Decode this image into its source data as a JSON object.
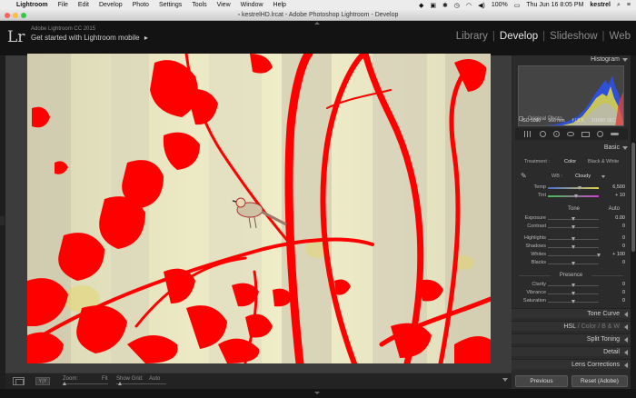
{
  "menubar": {
    "app": "Lightroom",
    "items": [
      "File",
      "Edit",
      "Develop",
      "Photo",
      "Settings",
      "Tools",
      "View",
      "Window",
      "Help"
    ],
    "battery": "100%",
    "datetime": "Thu Jun 16 8:05 PM",
    "user": "kestrel"
  },
  "window": {
    "title": "kestrelHD.lrcat - Adobe Photoshop Lightroom - Develop"
  },
  "identity": {
    "logo": "Lr",
    "product": "Adobe Lightroom CC 2015",
    "tagline": "Get started with Lightroom mobile",
    "tagline_arrow": "▸"
  },
  "modules": {
    "items": [
      "Library",
      "Develop",
      "Slideshow",
      "Web"
    ],
    "active": "Develop",
    "separator": "|"
  },
  "histogram": {
    "title": "Histogram",
    "iso": "ISO 5000",
    "focal": "566 mm",
    "aperture": "f / 5.6",
    "shutter": "1/1600 SEC",
    "original_photo": "Original Photo"
  },
  "toolstrip": {
    "icons": [
      "grid-overlay-icon",
      "crop-icon",
      "spot-removal-icon",
      "red-eye-icon",
      "graduated-filter-icon",
      "radial-filter-icon",
      "adjustment-brush-icon"
    ]
  },
  "basic": {
    "title": "Basic",
    "treatment_label": "Treatment :",
    "color": "Color",
    "bw": "Black & White",
    "wb_label": "WB :",
    "wb_value": "Cloudy",
    "temp_label": "Temp",
    "temp_value": "6,500",
    "temp_pos": 0.62,
    "tint_label": "Tint",
    "tint_value": "+ 10",
    "tint_pos": 0.55,
    "tone_label": "Tone",
    "auto_label": "Auto",
    "sliders": [
      {
        "label": "Exposure",
        "value": "0.00",
        "pos": 0.5
      },
      {
        "label": "Contrast",
        "value": "0",
        "pos": 0.5
      },
      {
        "label": "Highlights",
        "value": "0",
        "pos": 0.5
      },
      {
        "label": "Shadows",
        "value": "0",
        "pos": 0.5
      },
      {
        "label": "Whites",
        "value": "+ 100",
        "pos": 1.0
      },
      {
        "label": "Blacks",
        "value": "0",
        "pos": 0.5
      }
    ],
    "presence_label": "Presence",
    "presence": [
      {
        "label": "Clarity",
        "value": "0",
        "pos": 0.5
      },
      {
        "label": "Vibrance",
        "value": "0",
        "pos": 0.5
      },
      {
        "label": "Saturation",
        "value": "0",
        "pos": 0.5
      }
    ]
  },
  "panels": {
    "tone_curve": "Tone Curve",
    "hsl": "HSL",
    "color": "Color",
    "bw": "B & W",
    "split_toning": "Split Toning",
    "detail": "Detail",
    "lens_corrections": "Lens Corrections"
  },
  "buttons": {
    "previous": "Previous",
    "reset": "Reset (Adobe)"
  },
  "toolbar": {
    "zoom_label": "Zoom:",
    "zoom_value": "Fit",
    "grid_label": "Show Grid:",
    "grid_value": "Auto",
    "view_compare": "Y|Y"
  },
  "colors": {
    "clipping": "#ff0000",
    "panel_bg": "#2b2b2b",
    "canvas_bg": "#3c3c3c"
  }
}
